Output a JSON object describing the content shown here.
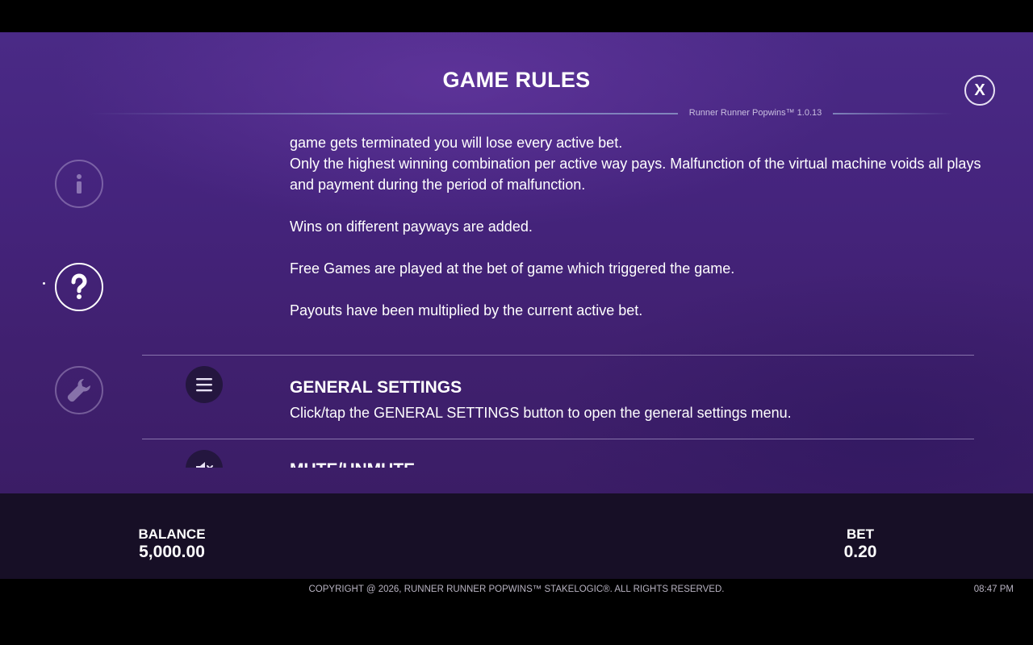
{
  "header": {
    "title": "GAME RULES",
    "version": "Runner Runner Popwins™ 1.0.13",
    "close_label": "X"
  },
  "sidebar": {
    "items": [
      {
        "name": "info",
        "icon": "info-icon",
        "active": false
      },
      {
        "name": "help",
        "icon": "question-icon",
        "active": true
      },
      {
        "name": "settings",
        "icon": "wrench-icon",
        "active": false
      }
    ]
  },
  "rules": {
    "lines": [
      "game gets terminated you will lose every active bet.",
      "Only the highest winning combination per active way pays. Malfunction of the virtual machine voids all plays and payment during the period of malfunction.",
      "Wins on different payways are added.",
      "Free Games are played at the bet of game which triggered the game.",
      "Payouts have been multiplied by the current active bet."
    ]
  },
  "sections": {
    "general_settings": {
      "icon": "hamburger-menu-icon",
      "heading": "GENERAL SETTINGS",
      "description": "Click/tap the GENERAL SETTINGS button to open the general settings menu."
    },
    "mute": {
      "icon": "speaker-mute-icon",
      "heading": "MUTE/UNMUTE"
    }
  },
  "status_bar": {
    "balance_label": "BALANCE",
    "balance_value": "5,000.00",
    "bet_label": "BET",
    "bet_value": "0.20"
  },
  "footer": {
    "copyright": "COPYRIGHT @ 2026, RUNNER RUNNER POPWINS™ STAKELOGIC®. ALL RIGHTS RESERVED.",
    "time": "08:47 PM"
  },
  "colors": {
    "panel_top": "#4a2a86",
    "panel_bottom": "#3b1d66",
    "bottom_bar": "#170f26",
    "icon_disc": "#24163f"
  }
}
